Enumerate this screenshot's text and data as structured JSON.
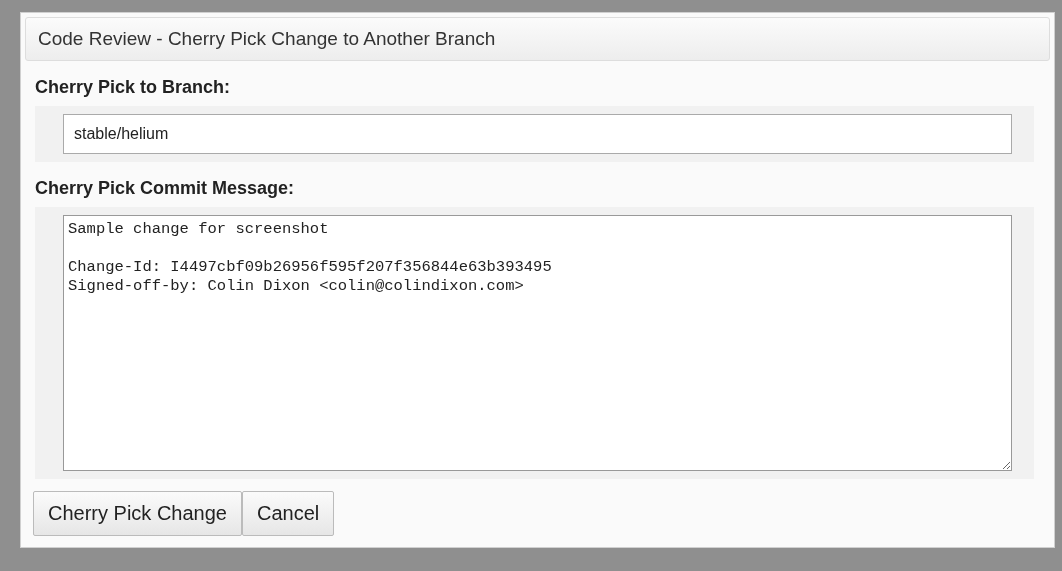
{
  "dialog": {
    "title": "Code Review - Cherry Pick Change to Another Branch",
    "branch_field": {
      "label": "Cherry Pick to Branch:",
      "value": "stable/helium"
    },
    "message_field": {
      "label": "Cherry Pick Commit Message:",
      "value": "Sample change for screenshot\n\nChange-Id: I4497cbf09b26956f595f207f356844e63b393495\nSigned-off-by: Colin Dixon <colin@colindixon.com>"
    },
    "buttons": [
      {
        "label": "Cherry Pick Change"
      },
      {
        "label": "Cancel"
      }
    ]
  }
}
